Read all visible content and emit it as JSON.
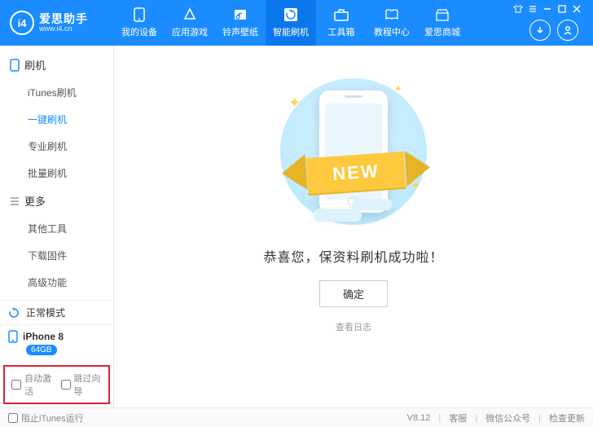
{
  "brand": {
    "name": "爱思助手",
    "url": "www.i4.cn",
    "logo_text": "i4"
  },
  "nav": [
    {
      "label": "我的设备"
    },
    {
      "label": "应用游戏"
    },
    {
      "label": "铃声壁纸"
    },
    {
      "label": "智能刷机"
    },
    {
      "label": "工具箱"
    },
    {
      "label": "教程中心"
    },
    {
      "label": "爱思商城"
    }
  ],
  "nav_active_index": 3,
  "sidebar": {
    "groups": [
      {
        "title": "刷机",
        "icon": "phone",
        "items": [
          {
            "label": "iTunes刷机"
          },
          {
            "label": "一键刷机"
          },
          {
            "label": "专业刷机"
          },
          {
            "label": "批量刷机"
          }
        ],
        "active_index": 1
      },
      {
        "title": "更多",
        "icon": "menu",
        "items": [
          {
            "label": "其他工具"
          },
          {
            "label": "下载固件"
          },
          {
            "label": "高级功能"
          }
        ],
        "active_index": -1
      }
    ],
    "mode_label": "正常模式",
    "device": {
      "name": "iPhone 8",
      "storage": "64GB"
    },
    "check_auto_activate": "自动激活",
    "check_skip_wizard": "跳过向导"
  },
  "content": {
    "ribbon_text": "NEW",
    "success_message": "恭喜您，保资料刷机成功啦！",
    "ok_button": "确定",
    "view_log": "查看日志"
  },
  "footer": {
    "block_itunes": "阻止iTunes运行",
    "version": "V8.12",
    "support": "客服",
    "wechat": "微信公众号",
    "check_update": "检查更新"
  }
}
